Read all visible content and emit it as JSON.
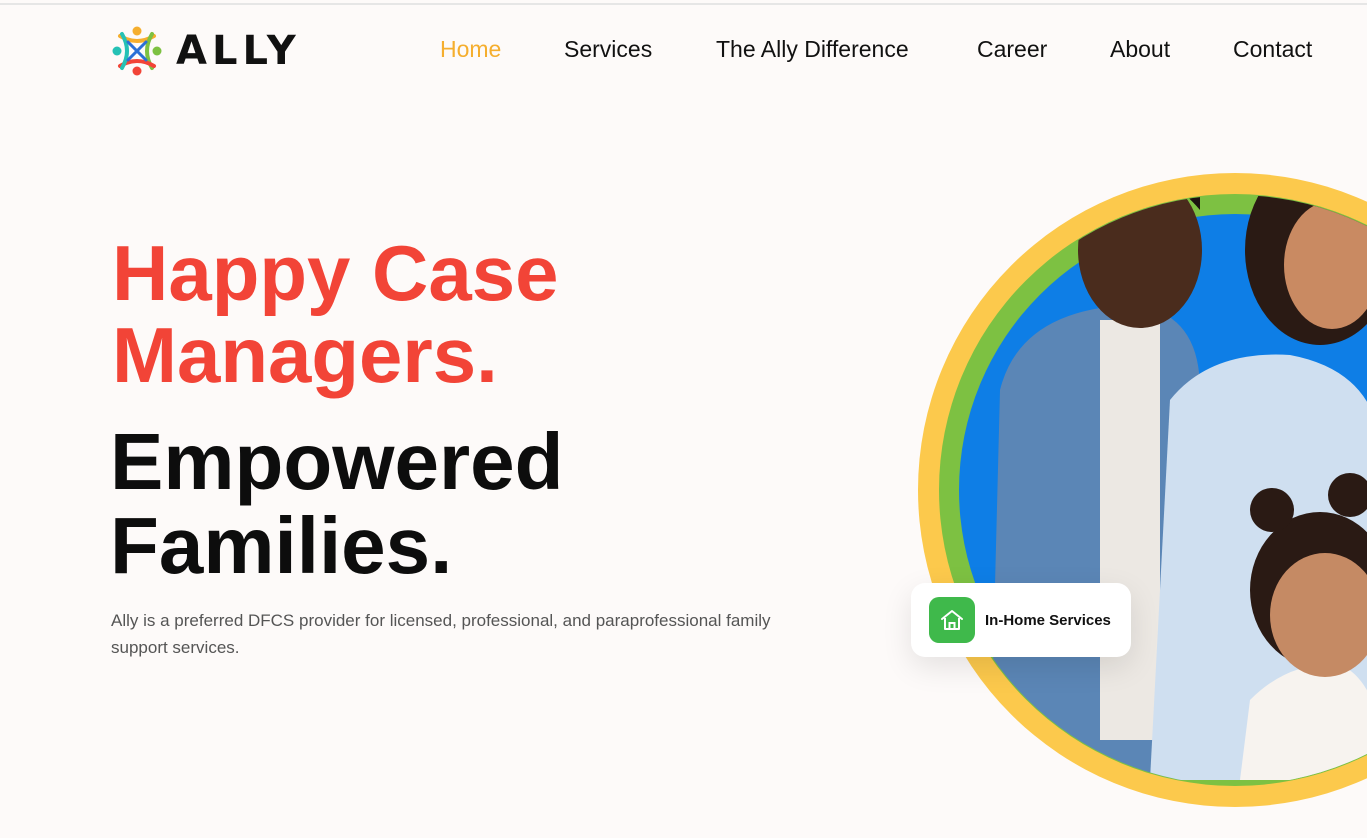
{
  "brand": {
    "name": "ALLY",
    "colors": {
      "red": "#f24437",
      "yellow": "#f5ae2e",
      "green": "#3fb94b",
      "blue": "#0e7ee6"
    }
  },
  "nav": {
    "items": [
      {
        "label": "Home",
        "active": true
      },
      {
        "label": "Services",
        "active": false
      },
      {
        "label": "The Ally Difference",
        "active": false
      },
      {
        "label": "Career",
        "active": false
      },
      {
        "label": "About",
        "active": false
      },
      {
        "label": "Contact",
        "active": false
      }
    ]
  },
  "hero": {
    "headline_red": "Happy Case Managers.",
    "headline_black": "Empowered Families.",
    "description": "Ally is a preferred DFCS provider for licensed, professional, and paraprofessional family support services.",
    "badge": {
      "icon": "house-icon",
      "label": "In-Home Services"
    },
    "image": {
      "content": "family-photo",
      "ring_colors": [
        "#fcc94c",
        "#7dc142",
        "#0e7ee6"
      ]
    }
  }
}
